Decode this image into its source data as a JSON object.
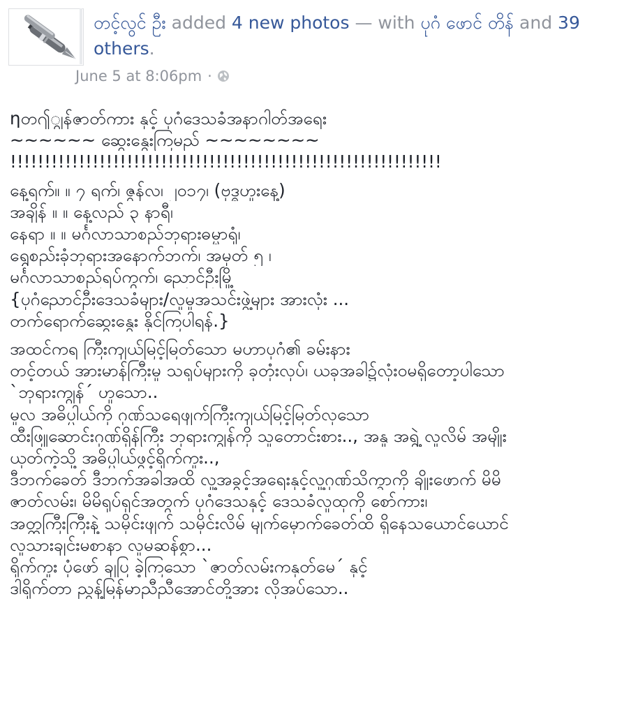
{
  "post": {
    "author": "တင့်လွင် ဦး",
    "action_text": " added ",
    "photos_link": "4 new photos",
    "with_text": " — with ",
    "tagged_person": "ပုဂံ ဖောင် တိန်",
    "and_text": " and ",
    "others_link": "39 others",
    "period": ".",
    "timestamp": "June 5 at 8:06pm",
    "separator": "·",
    "privacy_icon": "globe-icon",
    "body": {
      "paragraphs": [
        [
          "ηတ႟ျွန်ဇာတ်ကား နှင့် ပုဂံဒေသခံအနာဂါတ်အရေး",
          "~~~~~~ ဆွေးနွေးကြမည် ~~~~~~~~",
          "!!!!!!!!!!!!!!!!!!!!!!!!!!!!!!!!!!!!!!!!!!!!!!!!!!!!!!!!!!!!!!!"
        ],
        [
          "နေ့ရက်။ ။ ၇ ရက်၊ ဇွန်လ၊ ၂၀၁၇၊ (ဗုဒ္ဓဟူးနေ့)",
          "အချိန် ။ ။ နေ့လည် ၃ နာရီ၊",
          "နေရာ ။ ။ မင်္ဂလာသာစည်ဘုရားဓမ္မာရုံ၊",
          "ရွှေစည်းခုံဘုရားအနောက်ဘက်၊ အမှတ် ၅ ၊",
          "မင်္ဂလာသာစည်ရပ်ကွက်၊ ညောင်ဦးမြို့",
          "{ပုဂံညောင်ဦးဒေသခံများ/လူမှုအသင်းဖွဲ့များ အားလုံး ...",
          "တက်ရောက်ဆွေးနွေး နိုင်ကြပါရန်.}"
        ],
        [
          "အထင်ကရ ကြီးကျယ်မြင့်မြတ်သော မဟာပုဂံ၏ ခမ်းနား",
          "တင့်တယ် အားမာန်ကြီးမှု သရုပ်များကို ခုတုံးလုပ်၊ ယခုအခါ၌လုံးဝမရှိတော့ပါသော",
          "`ဘုရားကျွန်´ ဟူသော..",
          "မူလ အဓိပ္ပါယ်ကို ဂုဏ်သရေဖျက်ကြီးကျယ်မြင့်မြတ်လှသော",
          "ထီးဖြူဆောင်းဂုဏ်ရှိန်ကြီး ဘုရားကျွန်ကို သူတောင်းစား.., အနူ အရွဲ့ လူလိမ် အမျိုး",
          "ယုတ်ကဲ့သို့ အဓိပ္ပါယ်ဖွင့်ရိုက်ကူး..,",
          "ဒီဘက်ခေတ် ဒီဘက်အခါအထိ လူ့အခွင့်အရေးနှင့်လူ့ဂုဏ်သိက္ခာကို ချိုးဖောက် မိမိ",
          "ဇာတ်လမ်း၊ မိမိရုပ်ရှင်အတွက် ပုဂံဒေသနှင့် ဒေသခံလူထုကို စော်ကား၊",
          "အတ္တကြီးကြီးနဲ့ သမိုင်းဖျက် သမိုင်းလိမ် မျက်မှောက်ခေတ်ထိ ရှိနေသယောင်ယောင်",
          "လူသားချင်းမစာနာ လူမဆန်စွာ...",
          "ရိုက်ကူး ပုံဖော် ချပြ ခဲ့ကြသော `ဇာတ်လမ်းကနုတ်မေ´ နှင့်",
          "ဒါရိုက်တာ ညွန့်မြန်မာညီညီအောင်တို့အား လိုအပ်သော.."
        ]
      ]
    }
  },
  "colors": {
    "link": "#365899",
    "meta": "#90949c",
    "text": "#1d2129"
  }
}
